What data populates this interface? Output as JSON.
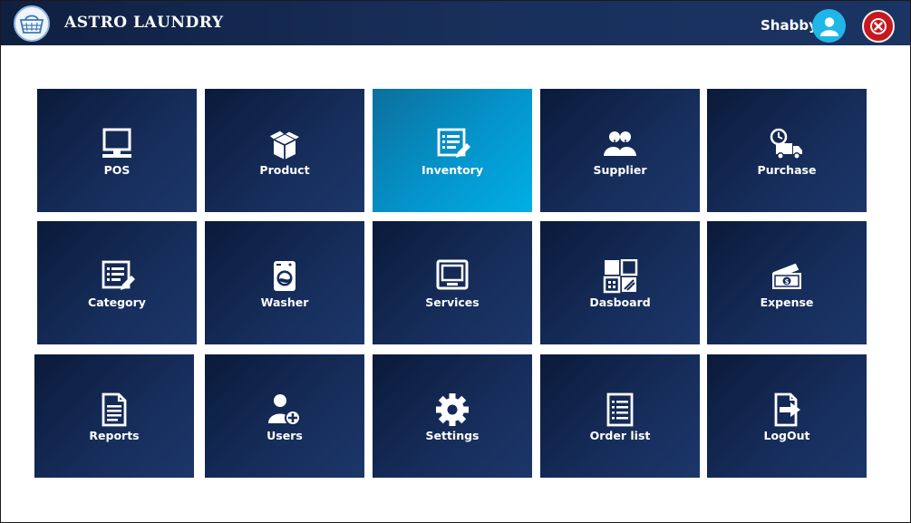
{
  "header": {
    "app_title": "ASTRO LAUNDRY",
    "user_name": "Shabby",
    "logo_icon": "laundry-basket-icon",
    "avatar_icon": "user-avatar-icon",
    "close_icon": "close-icon"
  },
  "colors": {
    "header_bg": "#162c55",
    "tile_bg": "#13295a",
    "tile_active_bg": "#03a6df",
    "avatar_bg": "#21b6e8",
    "close_bg": "#c8171e"
  },
  "menu": {
    "selected": "Inventory",
    "tiles": [
      {
        "label": "POS",
        "icon": "monitor-icon"
      },
      {
        "label": "Product",
        "icon": "box-icon"
      },
      {
        "label": "Inventory",
        "icon": "inventory-list-icon"
      },
      {
        "label": "Supplier",
        "icon": "users-group-icon"
      },
      {
        "label": "Purchase",
        "icon": "delivery-truck-icon"
      },
      {
        "label": "Category",
        "icon": "category-list-icon"
      },
      {
        "label": "Washer",
        "icon": "washing-machine-icon"
      },
      {
        "label": "Services",
        "icon": "screen-icon"
      },
      {
        "label": "Dasboard",
        "icon": "dashboard-grid-icon"
      },
      {
        "label": "Expense",
        "icon": "money-icon"
      },
      {
        "label": "Reports",
        "icon": "document-icon"
      },
      {
        "label": "Users",
        "icon": "add-user-icon"
      },
      {
        "label": "Settings",
        "icon": "gear-icon"
      },
      {
        "label": "Order list",
        "icon": "order-list-icon"
      },
      {
        "label": "LogOut",
        "icon": "logout-icon"
      }
    ]
  }
}
